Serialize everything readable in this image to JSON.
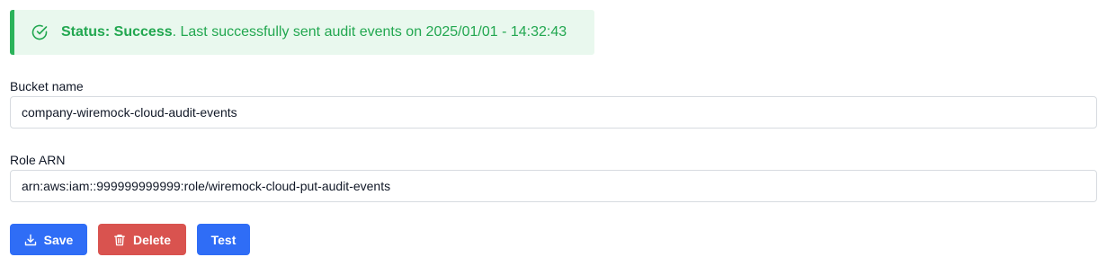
{
  "status": {
    "label": "Status: Success",
    "message": ". Last successfully sent audit events on 2025/01/01 - 14:32:43",
    "icon": "check-circle-icon",
    "color": "#22a750",
    "background": "#e9f8ee"
  },
  "form": {
    "bucket_label": "Bucket name",
    "bucket_value": "company-wiremock-cloud-audit-events",
    "role_label": "Role ARN",
    "role_value": "arn:aws:iam::999999999999:role/wiremock-cloud-put-audit-events"
  },
  "actions": {
    "save_label": "Save",
    "save_icon": "download-icon",
    "delete_label": "Delete",
    "delete_icon": "trash-icon",
    "test_label": "Test",
    "primary_color": "#2f6df6",
    "danger_color": "#d9534f"
  }
}
